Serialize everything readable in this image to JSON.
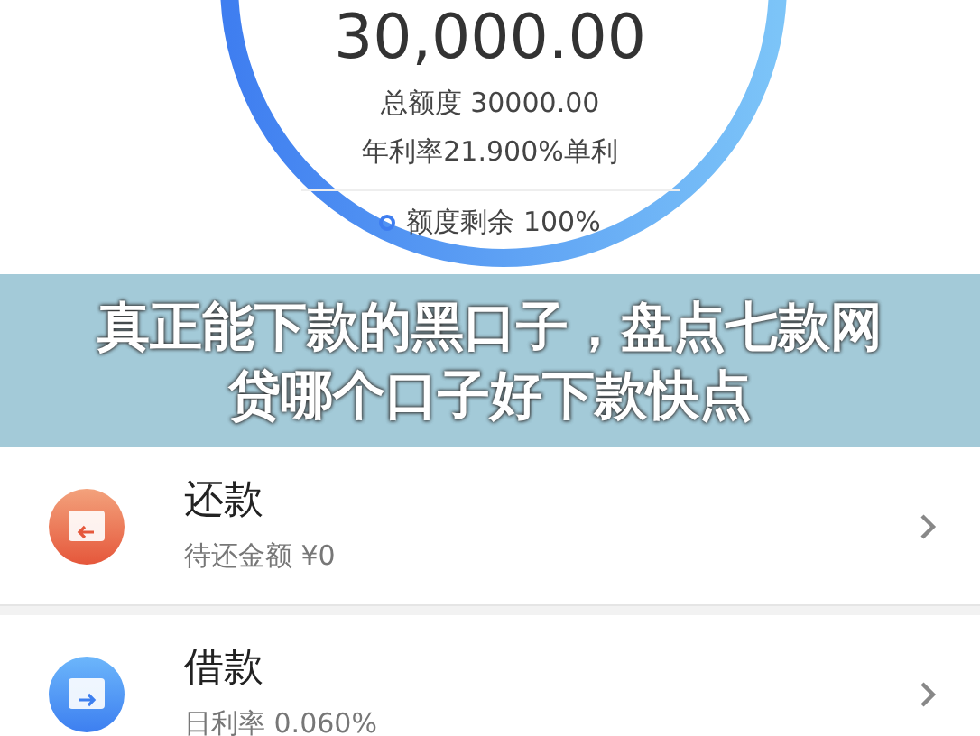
{
  "credit": {
    "available_amount": "30,000.00",
    "total_limit": "总额度 30000.00",
    "annual_rate": "年利率21.900%单利",
    "remaining": "额度剩余 100%"
  },
  "banner": {
    "title": "真正能下款的黑口子，盘点七款网贷哪个口子好下款快点"
  },
  "items": [
    {
      "kind": "repay",
      "title": "还款",
      "subtitle": "待还金额 ¥0"
    },
    {
      "kind": "borrow",
      "title": "借款",
      "subtitle": "日利率 0.060%"
    }
  ]
}
